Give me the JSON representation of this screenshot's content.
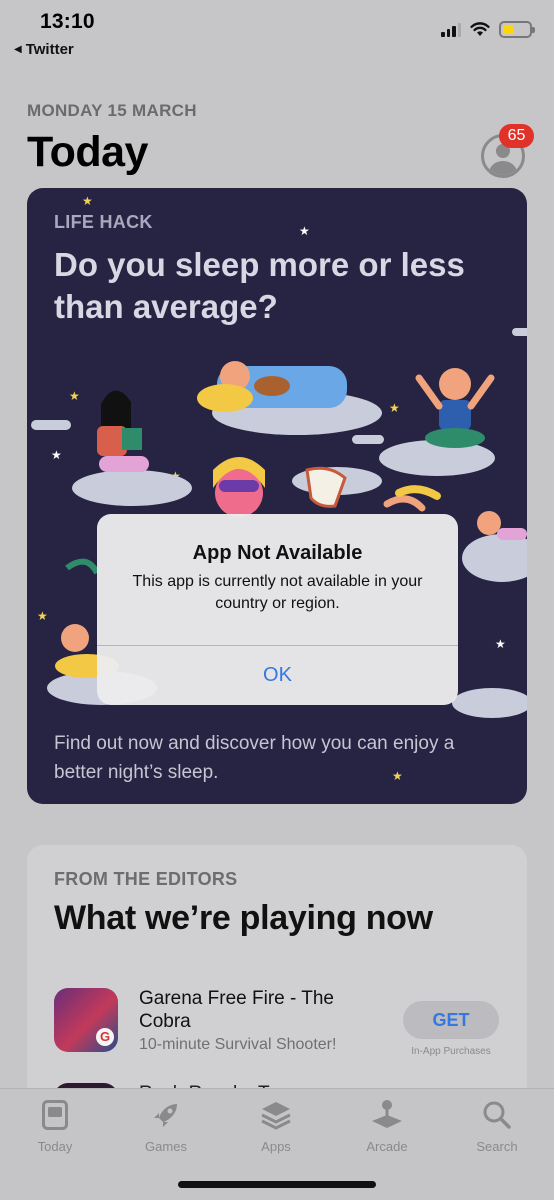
{
  "status_bar": {
    "time": "13:10",
    "back_app": "Twitter",
    "battery_color": "#ffd60a"
  },
  "header": {
    "date": "MONDAY 15 MARCH",
    "title": "Today",
    "badge_count": "65"
  },
  "feature_card": {
    "eyebrow": "LIFE HACK",
    "headline": "Do you sleep more or less than average?",
    "body": "Find out now and discover how you can enjoy a better night’s sleep.",
    "background": "#262442"
  },
  "alert": {
    "title": "App Not Available",
    "message": "This app is currently not available in your country or region.",
    "ok_label": "OK"
  },
  "editors_card": {
    "eyebrow": "FROM THE EDITORS",
    "headline": "What we’re playing now",
    "app": {
      "name": "Garena Free Fire - The Cobra",
      "subtitle": "10-minute Survival Shooter!",
      "get_label": "GET",
      "iap_note": "In-App Purchases"
    },
    "next_app_peek": "Rush Royale: T"
  },
  "tab_bar": {
    "tabs": [
      {
        "label": "Today",
        "icon": "today-icon"
      },
      {
        "label": "Games",
        "icon": "rocket-icon"
      },
      {
        "label": "Apps",
        "icon": "layers-icon"
      },
      {
        "label": "Arcade",
        "icon": "joystick-icon"
      },
      {
        "label": "Search",
        "icon": "search-icon"
      }
    ],
    "selected_index": 0
  },
  "colors": {
    "accent": "#3478e0",
    "badge": "#e1322a"
  }
}
